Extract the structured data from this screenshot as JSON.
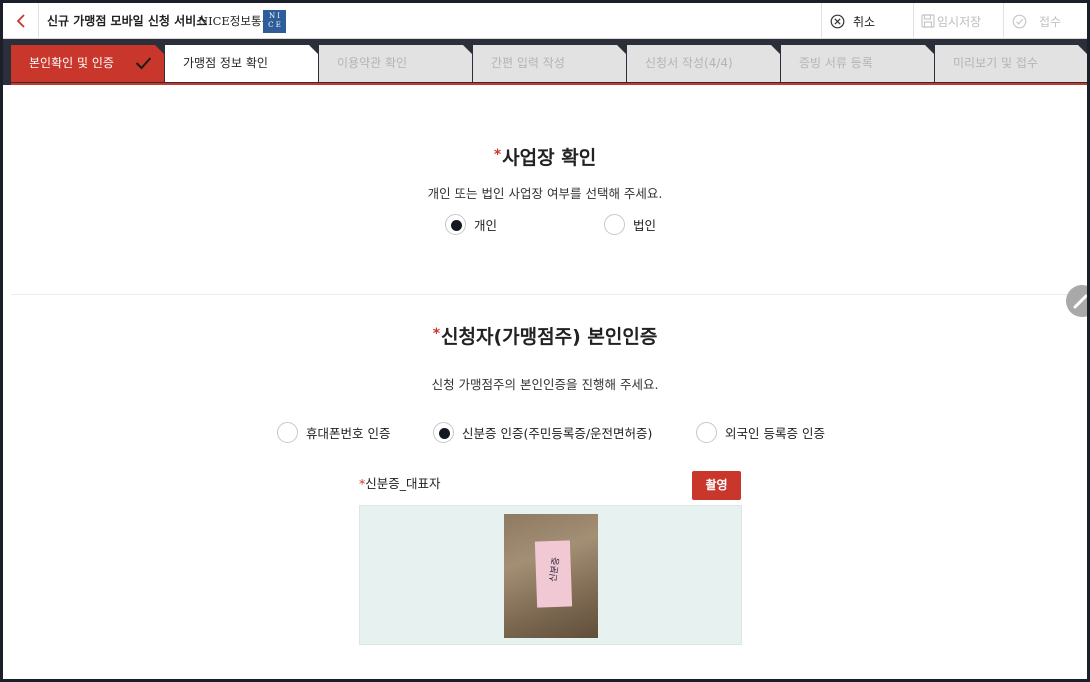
{
  "header": {
    "title": "신규 가맹점 모바일 신청 서비스",
    "logo_text": "NICE정보통신",
    "logo_mark_top": "N I",
    "logo_mark_bottom": "C E",
    "cancel_label": "취소",
    "save_label": "임시저장",
    "submit_label": "접수"
  },
  "steps": [
    {
      "label": "본인확인 및 인증",
      "state": "done"
    },
    {
      "label": "가맹점 정보 확인",
      "state": "current"
    },
    {
      "label": "이용약관 확인",
      "state": "todo"
    },
    {
      "label": "간편 입력 작성",
      "state": "todo"
    },
    {
      "label": "신청서 작성(4/4)",
      "state": "todo"
    },
    {
      "label": "증빙 서류 등록",
      "state": "todo"
    },
    {
      "label": "미리보기 및 접수",
      "state": "todo"
    }
  ],
  "business": {
    "required_mark": "*",
    "title": "사업장 확인",
    "description": "개인 또는 법인 사업장 여부를 선택해 주세요.",
    "options": [
      {
        "label": "개인",
        "checked": true
      },
      {
        "label": "법인",
        "checked": false
      }
    ]
  },
  "identity": {
    "required_mark": "*",
    "title": "신청자(가맹점주) 본인인증",
    "description": "신청 가맹점주의 본인인증을 진행해 주세요.",
    "options": [
      {
        "label": "휴대폰번호 인증",
        "checked": false
      },
      {
        "label": "신분증 인증(주민등록증/운전면허증)",
        "checked": true
      },
      {
        "label": "외국인 등록증 인증",
        "checked": false
      }
    ],
    "id_field": {
      "required_mark": "*",
      "label": "신분증_대표자",
      "button_label": "촬영",
      "photo_text": "신분증"
    }
  },
  "colors": {
    "accent": "#c9372c",
    "nav_dark": "#2b2f3a",
    "preview_bg": "#e6f1f0"
  }
}
